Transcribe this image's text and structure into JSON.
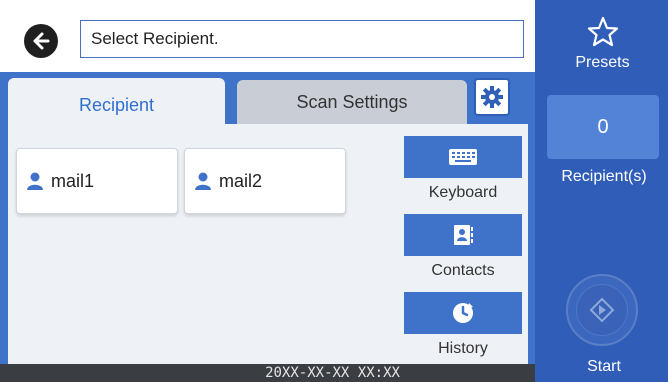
{
  "header": {
    "search_value": "Select Recipient."
  },
  "tabs": [
    {
      "label": "Recipient",
      "active": true
    },
    {
      "label": "Scan Settings",
      "active": false
    }
  ],
  "recipients": [
    {
      "label": "mail1",
      "icon": "person-icon"
    },
    {
      "label": "mail2",
      "icon": "person-icon"
    }
  ],
  "tools": {
    "keyboard_label": "Keyboard",
    "contacts_label": "Contacts",
    "history_label": "History"
  },
  "status_bar": {
    "datetime": "20XX-XX-XX XX:XX"
  },
  "right": {
    "presets_label": "Presets",
    "recipient_count": "0",
    "recipient_label": "Recipient(s)",
    "start_label": "Start"
  },
  "colors": {
    "primary_blue": "#3f72c9",
    "dark_blue": "#2f5db8",
    "status_bar": "#3a3d42",
    "tab_active_text": "#2f6fd1"
  }
}
